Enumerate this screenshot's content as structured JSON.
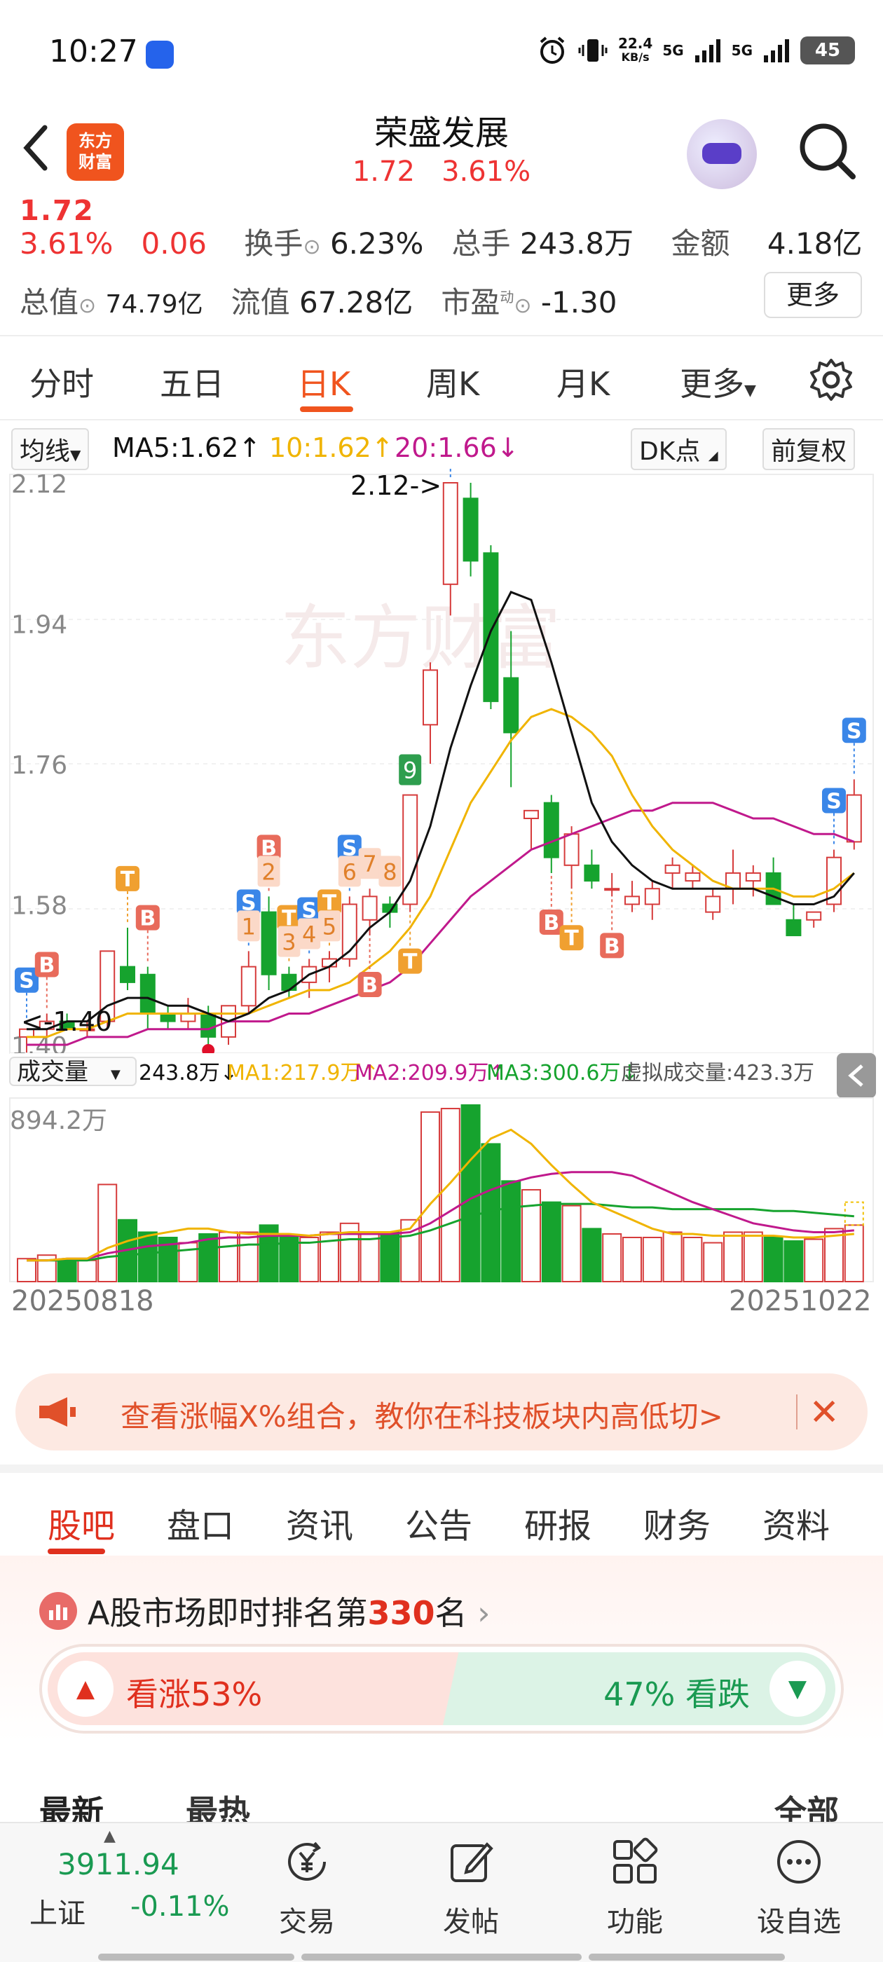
{
  "status": {
    "time": "10:27",
    "net_speed_value": "22.4",
    "net_speed_unit": "KB/s",
    "sig1": "5G",
    "sig2": "5G",
    "battery": "45"
  },
  "header": {
    "back_label": "<",
    "logo_line1": "东方",
    "logo_line2": "财富",
    "title": "荣盛发展",
    "price": "1.72",
    "change_pct": "3.61%"
  },
  "quote": {
    "price_cut": "1.72",
    "change_pct": "3.61%",
    "change_amt": "0.06",
    "turnover_label": "换手",
    "turnover": "6.23%",
    "volume_label": "总手",
    "volume": "243.8万",
    "amount_label": "金额",
    "amount": "4.18亿",
    "mcap_label": "总值",
    "mcap": "74.79亿",
    "float_label": "流值",
    "float": "67.28亿",
    "pe_label": "市盈",
    "pe_sup": "动",
    "pe": "-1.30",
    "more": "更多"
  },
  "ktabs": [
    "分时",
    "五日",
    "日K",
    "周K",
    "月K",
    "更多"
  ],
  "ktab_active": "日K",
  "ma_bar": {
    "indicator": "均线",
    "ma5": "MA5:1.62↑",
    "ma10": "10:1.62↑",
    "ma20": "20:1.66↓",
    "dk": "DK点",
    "adjust": "前复权"
  },
  "vol_bar": {
    "indicator": "成交量",
    "vol": "243.8万↓",
    "ma1": "MA1:217.9万↑",
    "ma2": "MA2:209.9万↑",
    "ma3": "MA3:300.6万↓",
    "virtual": "虚拟成交量:423.3万"
  },
  "chart_data": {
    "type": "candlestick",
    "y_ticks": [
      "2.12",
      "1.94",
      "1.76",
      "1.58",
      "1.40"
    ],
    "ylim": [
      1.4,
      2.12
    ],
    "high_label": "2.12->",
    "low_label": "<-1.40",
    "vol_max_label": "894.2万",
    "date_start": "20250818",
    "date_end": "20251022",
    "colors": {
      "up": "#d63b3b",
      "down": "#16a32e",
      "ma5": "#111111",
      "ma10": "#f0b400",
      "ma20": "#c0198c"
    },
    "candles": [
      {
        "o": 1.41,
        "h": 1.42,
        "l": 1.39,
        "c": 1.42
      },
      {
        "o": 1.42,
        "h": 1.44,
        "l": 1.41,
        "c": 1.43
      },
      {
        "o": 1.43,
        "h": 1.44,
        "l": 1.42,
        "c": 1.42
      },
      {
        "o": 1.42,
        "h": 1.43,
        "l": 1.41,
        "c": 1.42
      },
      {
        "o": 1.43,
        "h": 1.52,
        "l": 1.42,
        "c": 1.52
      },
      {
        "o": 1.5,
        "h": 1.55,
        "l": 1.47,
        "c": 1.48
      },
      {
        "o": 1.49,
        "h": 1.5,
        "l": 1.42,
        "c": 1.44
      },
      {
        "o": 1.44,
        "h": 1.45,
        "l": 1.42,
        "c": 1.43
      },
      {
        "o": 1.43,
        "h": 1.46,
        "l": 1.42,
        "c": 1.44
      },
      {
        "o": 1.44,
        "h": 1.45,
        "l": 1.4,
        "c": 1.41
      },
      {
        "o": 1.41,
        "h": 1.45,
        "l": 1.4,
        "c": 1.45
      },
      {
        "o": 1.45,
        "h": 1.52,
        "l": 1.44,
        "c": 1.5
      },
      {
        "o": 1.57,
        "h": 1.59,
        "l": 1.47,
        "c": 1.49
      },
      {
        "o": 1.49,
        "h": 1.5,
        "l": 1.46,
        "c": 1.47
      },
      {
        "o": 1.48,
        "h": 1.51,
        "l": 1.46,
        "c": 1.5
      },
      {
        "o": 1.5,
        "h": 1.52,
        "l": 1.48,
        "c": 1.51
      },
      {
        "o": 1.51,
        "h": 1.59,
        "l": 1.5,
        "c": 1.58
      },
      {
        "o": 1.56,
        "h": 1.6,
        "l": 1.54,
        "c": 1.59
      },
      {
        "o": 1.58,
        "h": 1.59,
        "l": 1.55,
        "c": 1.57
      },
      {
        "o": 1.58,
        "h": 1.72,
        "l": 1.57,
        "c": 1.72
      },
      {
        "o": 1.81,
        "h": 1.89,
        "l": 1.76,
        "c": 1.88
      },
      {
        "o": 1.99,
        "h": 2.12,
        "l": 1.95,
        "c": 2.12
      },
      {
        "o": 2.1,
        "h": 2.12,
        "l": 2.0,
        "c": 2.02
      },
      {
        "o": 2.03,
        "h": 2.04,
        "l": 1.83,
        "c": 1.84
      },
      {
        "o": 1.87,
        "h": 1.93,
        "l": 1.73,
        "c": 1.8
      },
      {
        "o": 1.69,
        "h": 1.7,
        "l": 1.65,
        "c": 1.7
      },
      {
        "o": 1.71,
        "h": 1.72,
        "l": 1.62,
        "c": 1.64
      },
      {
        "o": 1.63,
        "h": 1.68,
        "l": 1.6,
        "c": 1.67
      },
      {
        "o": 1.63,
        "h": 1.65,
        "l": 1.6,
        "c": 1.61
      },
      {
        "o": 1.6,
        "h": 1.62,
        "l": 1.59,
        "c": 1.6
      },
      {
        "o": 1.58,
        "h": 1.61,
        "l": 1.57,
        "c": 1.59
      },
      {
        "o": 1.58,
        "h": 1.61,
        "l": 1.56,
        "c": 1.6
      },
      {
        "o": 1.62,
        "h": 1.64,
        "l": 1.6,
        "c": 1.63
      },
      {
        "o": 1.61,
        "h": 1.63,
        "l": 1.6,
        "c": 1.62
      },
      {
        "o": 1.57,
        "h": 1.6,
        "l": 1.56,
        "c": 1.59
      },
      {
        "o": 1.6,
        "h": 1.65,
        "l": 1.58,
        "c": 1.62
      },
      {
        "o": 1.61,
        "h": 1.63,
        "l": 1.59,
        "c": 1.62
      },
      {
        "o": 1.62,
        "h": 1.64,
        "l": 1.59,
        "c": 1.58
      },
      {
        "o": 1.56,
        "h": 1.58,
        "l": 1.55,
        "c": 1.54
      },
      {
        "o": 1.56,
        "h": 1.57,
        "l": 1.55,
        "c": 1.57
      },
      {
        "o": 1.58,
        "h": 1.65,
        "l": 1.57,
        "c": 1.64
      },
      {
        "o": 1.66,
        "h": 1.74,
        "l": 1.65,
        "c": 1.72
      }
    ],
    "ma5": [
      1.42,
      1.42,
      1.43,
      1.43,
      1.45,
      1.46,
      1.46,
      1.45,
      1.45,
      1.44,
      1.43,
      1.44,
      1.46,
      1.47,
      1.49,
      1.5,
      1.52,
      1.55,
      1.57,
      1.61,
      1.68,
      1.78,
      1.86,
      1.93,
      1.98,
      1.97,
      1.89,
      1.8,
      1.71,
      1.66,
      1.63,
      1.61,
      1.6,
      1.6,
      1.6,
      1.6,
      1.6,
      1.59,
      1.58,
      1.58,
      1.59,
      1.62
    ],
    "ma10": [
      1.41,
      1.41,
      1.42,
      1.42,
      1.43,
      1.44,
      1.44,
      1.44,
      1.44,
      1.44,
      1.44,
      1.44,
      1.45,
      1.46,
      1.47,
      1.47,
      1.48,
      1.5,
      1.52,
      1.55,
      1.59,
      1.65,
      1.71,
      1.75,
      1.79,
      1.82,
      1.83,
      1.82,
      1.8,
      1.77,
      1.72,
      1.68,
      1.65,
      1.63,
      1.61,
      1.6,
      1.6,
      1.6,
      1.59,
      1.59,
      1.6,
      1.62
    ],
    "ma20": [
      1.4,
      1.4,
      1.4,
      1.41,
      1.41,
      1.41,
      1.42,
      1.42,
      1.42,
      1.42,
      1.43,
      1.43,
      1.43,
      1.44,
      1.44,
      1.45,
      1.46,
      1.47,
      1.48,
      1.5,
      1.53,
      1.56,
      1.59,
      1.61,
      1.63,
      1.65,
      1.66,
      1.67,
      1.68,
      1.69,
      1.7,
      1.7,
      1.71,
      1.71,
      1.71,
      1.7,
      1.69,
      1.69,
      1.68,
      1.67,
      1.67,
      1.66
    ],
    "volume_pct": [
      0.13,
      0.15,
      0.12,
      0.12,
      0.55,
      0.35,
      0.28,
      0.25,
      0.22,
      0.27,
      0.28,
      0.28,
      0.32,
      0.25,
      0.25,
      0.28,
      0.33,
      0.27,
      0.28,
      0.35,
      0.96,
      0.98,
      1.0,
      0.78,
      0.57,
      0.52,
      0.45,
      0.43,
      0.3,
      0.27,
      0.25,
      0.25,
      0.28,
      0.25,
      0.22,
      0.28,
      0.28,
      0.25,
      0.23,
      0.24,
      0.3,
      0.32
    ],
    "vol_ma1": [
      0.12,
      0.12,
      0.13,
      0.13,
      0.19,
      0.23,
      0.26,
      0.28,
      0.3,
      0.3,
      0.28,
      0.27,
      0.27,
      0.27,
      0.26,
      0.27,
      0.28,
      0.28,
      0.28,
      0.3,
      0.44,
      0.56,
      0.69,
      0.81,
      0.86,
      0.78,
      0.66,
      0.55,
      0.45,
      0.4,
      0.35,
      0.3,
      0.27,
      0.27,
      0.26,
      0.26,
      0.26,
      0.26,
      0.25,
      0.25,
      0.26,
      0.27
    ],
    "vol_ma2": [
      0.12,
      0.12,
      0.13,
      0.13,
      0.16,
      0.18,
      0.2,
      0.21,
      0.22,
      0.24,
      0.25,
      0.25,
      0.26,
      0.26,
      0.26,
      0.27,
      0.27,
      0.27,
      0.27,
      0.28,
      0.33,
      0.4,
      0.47,
      0.52,
      0.56,
      0.59,
      0.61,
      0.62,
      0.62,
      0.62,
      0.6,
      0.55,
      0.5,
      0.45,
      0.41,
      0.37,
      0.33,
      0.31,
      0.29,
      0.28,
      0.28,
      0.29
    ],
    "vol_ma3": [
      0.12,
      0.12,
      0.12,
      0.12,
      0.14,
      0.15,
      0.16,
      0.17,
      0.18,
      0.19,
      0.2,
      0.21,
      0.21,
      0.22,
      0.22,
      0.23,
      0.24,
      0.24,
      0.25,
      0.26,
      0.29,
      0.33,
      0.37,
      0.4,
      0.42,
      0.43,
      0.44,
      0.44,
      0.44,
      0.43,
      0.42,
      0.42,
      0.41,
      0.41,
      0.41,
      0.41,
      0.41,
      0.4,
      0.4,
      0.39,
      0.38,
      0.37
    ],
    "signals": [
      {
        "i": 0,
        "t": "S",
        "pos": "above",
        "color": "#3a86e8"
      },
      {
        "i": 1,
        "t": "B",
        "pos": "above",
        "color": "#e86b5b"
      },
      {
        "i": 5,
        "t": "T",
        "pos": "above",
        "color": "#f0a030"
      },
      {
        "i": 6,
        "t": "B",
        "pos": "above",
        "color": "#e86b5b"
      },
      {
        "i": 11,
        "t": "S",
        "pos": "above",
        "color": "#3a86e8"
      },
      {
        "i": 12,
        "t": "B",
        "pos": "above",
        "color": "#e86b5b"
      },
      {
        "i": 13,
        "t": "T",
        "pos": "above",
        "color": "#f0a030"
      },
      {
        "i": 14,
        "t": "S",
        "pos": "above",
        "color": "#3a86e8"
      },
      {
        "i": 15,
        "t": "T",
        "pos": "above",
        "color": "#f0a030"
      },
      {
        "i": 16,
        "t": "S",
        "pos": "above",
        "color": "#3a86e8"
      },
      {
        "i": 17,
        "t": "B",
        "pos": "below",
        "color": "#e86b5b"
      },
      {
        "i": 19,
        "t": "T",
        "pos": "below",
        "color": "#f0a030"
      },
      {
        "i": 21,
        "t": "S",
        "pos": "above",
        "color": "#3a86e8"
      },
      {
        "i": 26,
        "t": "B",
        "pos": "below",
        "color": "#e86b5b"
      },
      {
        "i": 27,
        "t": "T",
        "pos": "below",
        "color": "#f0a030"
      },
      {
        "i": 29,
        "t": "B",
        "pos": "below",
        "color": "#e86b5b"
      },
      {
        "i": 40,
        "t": "S",
        "pos": "above",
        "color": "#3a86e8"
      },
      {
        "i": 41,
        "t": "S",
        "pos": "above",
        "color": "#3a86e8"
      }
    ],
    "td_counts": [
      {
        "i": 11,
        "t": "1"
      },
      {
        "i": 12,
        "t": "2"
      },
      {
        "i": 13,
        "t": "3"
      },
      {
        "i": 14,
        "t": "4"
      },
      {
        "i": 15,
        "t": "5"
      },
      {
        "i": 16,
        "t": "6"
      },
      {
        "i": 17,
        "t": "7"
      },
      {
        "i": 18,
        "t": "8"
      },
      {
        "i": 19,
        "t": "9"
      }
    ]
  },
  "banner": {
    "text": "查看涨幅X%组合，教你在科技板块内高低切>",
    "close": "✕"
  },
  "gtabs": [
    "股吧",
    "盘口",
    "资讯",
    "公告",
    "研报",
    "财务",
    "资料"
  ],
  "rank": {
    "prefix": "A股市场即时排名第",
    "num": "330",
    "suffix": "名",
    "chevron": "›"
  },
  "vote": {
    "up": "看涨53%",
    "down": "47% 看跌",
    "up_pct": 53,
    "down_pct": 47
  },
  "sort": {
    "latest": "最新",
    "hot": "最热",
    "all": "全部"
  },
  "bottom": {
    "index_value": "3911.94",
    "index_name": "上证",
    "index_change": "-0.11%",
    "items": [
      "交易",
      "发帖",
      "功能",
      "设自选"
    ]
  }
}
